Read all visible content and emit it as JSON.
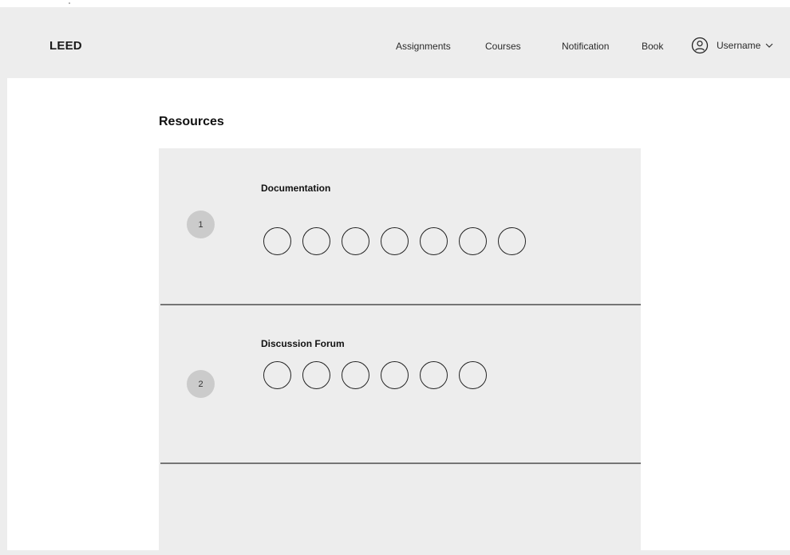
{
  "brand": {
    "name": "LEED"
  },
  "nav": {
    "links": [
      {
        "label": "Assignments"
      },
      {
        "label": "Courses"
      },
      {
        "label": "Notification"
      },
      {
        "label": "Book"
      }
    ],
    "user": {
      "label": "Username",
      "icon": "user-icon",
      "dropdown_icon": "chevron-down-icon"
    }
  },
  "main": {
    "title": "Resources",
    "sections": [
      {
        "number": "1",
        "title": "Documentation",
        "item_count": 7
      },
      {
        "number": "2",
        "title": "Discussion Forum",
        "item_count": 6
      }
    ]
  },
  "colors": {
    "page_background": "#ededed",
    "content_background": "#ffffff",
    "panel_background": "#ededed",
    "badge_background": "#cbcbcb",
    "divider": "#757575"
  }
}
